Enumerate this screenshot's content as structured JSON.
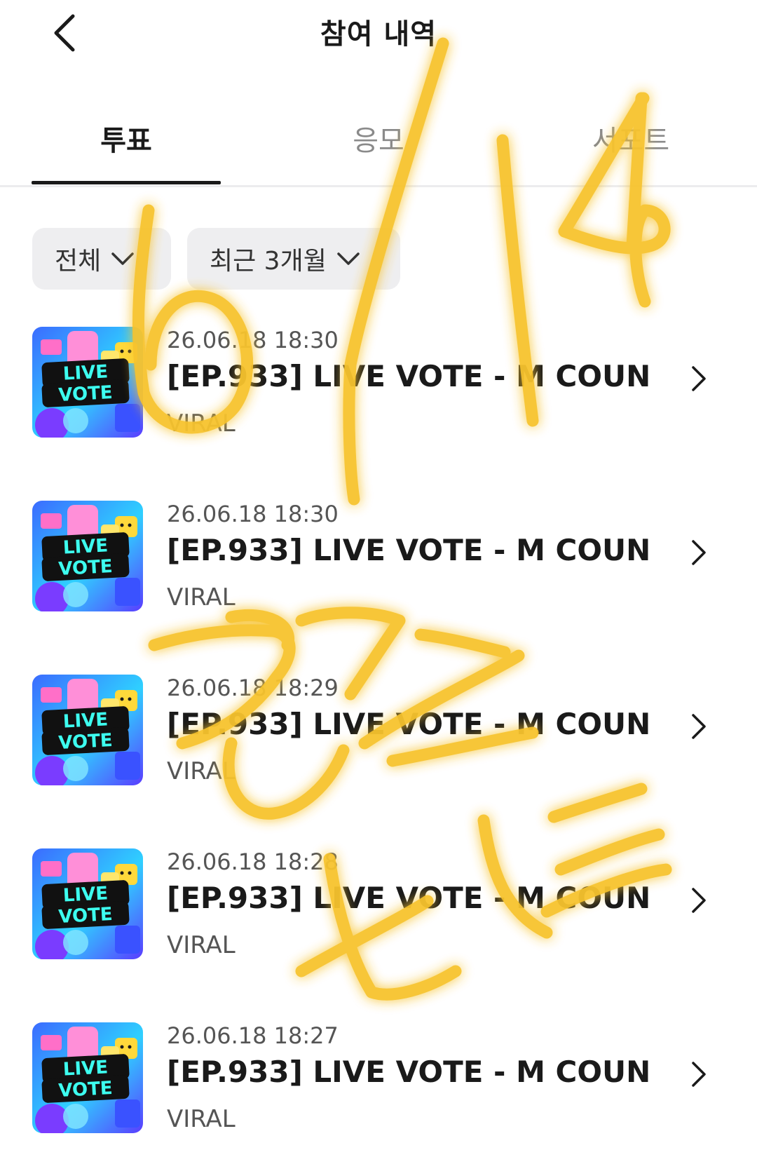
{
  "header": {
    "title": "참여 내역",
    "back_icon": "chevron-left-icon"
  },
  "tabs": [
    {
      "label": "투표",
      "active": true
    },
    {
      "label": "응모",
      "active": false
    },
    {
      "label": "서포트",
      "active": false
    }
  ],
  "filters": [
    {
      "label": "전체",
      "icon": "chevron-down-icon"
    },
    {
      "label": "최근 3개월",
      "icon": "chevron-down-icon"
    }
  ],
  "items": [
    {
      "date": "26.06.18 18:30",
      "title": "[EP.933] LIVE VOTE - M COUN...",
      "source": "VIRAL",
      "thumb_text_1": "LIVE",
      "thumb_text_2": "VOTE"
    },
    {
      "date": "26.06.18 18:30",
      "title": "[EP.933] LIVE VOTE - M COUN...",
      "source": "VIRAL",
      "thumb_text_1": "LIVE",
      "thumb_text_2": "VOTE"
    },
    {
      "date": "26.06.18 18:29",
      "title": "[EP.933] LIVE VOTE - M COUN...",
      "source": "VIRAL",
      "thumb_text_1": "LIVE",
      "thumb_text_2": "VOTE"
    },
    {
      "date": "26.06.18 18:28",
      "title": "[EP.933] LIVE VOTE - M COUN...",
      "source": "VIRAL",
      "thumb_text_1": "LIVE",
      "thumb_text_2": "VOTE"
    },
    {
      "date": "26.06.18 18:27",
      "title": "[EP.933] LIVE VOTE - M COUN...",
      "source": "VIRAL",
      "thumb_text_1": "LIVE",
      "thumb_text_2": "VOTE"
    }
  ],
  "colors": {
    "scribble": "#f7c32e",
    "scribble_glow": "#ffe27a",
    "tab_active": "#1a1a1a",
    "chip_bg": "#eeeef0"
  }
}
